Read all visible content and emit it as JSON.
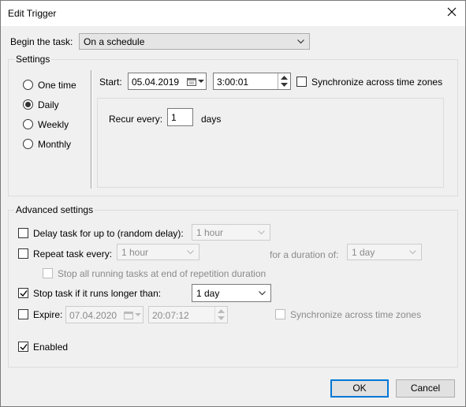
{
  "window": {
    "title": "Edit Trigger"
  },
  "begin_task": {
    "label": "Begin the task:",
    "value": "On a schedule"
  },
  "settings": {
    "group_label": "Settings",
    "schedule_options": [
      {
        "label": "One time",
        "selected": false
      },
      {
        "label": "Daily",
        "selected": true
      },
      {
        "label": "Weekly",
        "selected": false
      },
      {
        "label": "Monthly",
        "selected": false
      }
    ],
    "start_label": "Start:",
    "start_date": "05.04.2019",
    "start_time": "3:00:01",
    "sync_label": "Synchronize across time zones",
    "recur_label": "Recur every:",
    "recur_value": "1",
    "recur_unit": "days"
  },
  "advanced": {
    "group_label": "Advanced settings",
    "delay_label": "Delay task for up to (random delay):",
    "delay_value": "1 hour",
    "repeat_label": "Repeat task every:",
    "repeat_value": "1 hour",
    "duration_label": "for a duration of:",
    "duration_value": "1 day",
    "stop_all_label": "Stop all running tasks at end of repetition duration",
    "stop_if_label": "Stop task if it runs longer than:",
    "stop_if_value": "1 day",
    "expire_label": "Expire:",
    "expire_date": "07.04.2020",
    "expire_time": "20:07:12",
    "expire_sync_label": "Synchronize across time zones",
    "enabled_label": "Enabled"
  },
  "buttons": {
    "ok": "OK",
    "cancel": "Cancel"
  }
}
